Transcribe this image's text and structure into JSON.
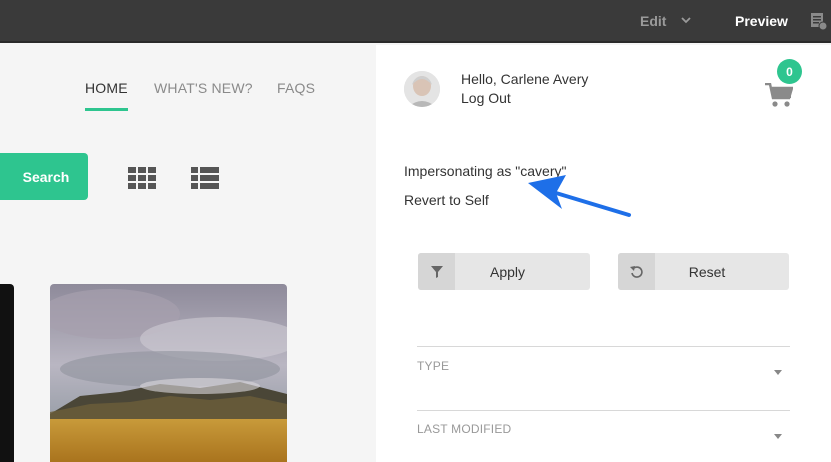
{
  "topbar": {
    "edit_label": "Edit",
    "preview_label": "Preview",
    "icons": [
      "chevron-down-icon",
      "panel-settings-icon"
    ]
  },
  "nav": {
    "items": [
      {
        "label": "HOME",
        "active": true
      },
      {
        "label": "WHAT'S NEW?",
        "active": false
      },
      {
        "label": "FAQS",
        "active": false
      }
    ]
  },
  "search": {
    "button_label": "Search"
  },
  "view_toggle": {
    "icons": [
      "grid-view-icon",
      "list-view-icon"
    ]
  },
  "user": {
    "greeting": "Hello, Carlene Avery",
    "logout_label": "Log Out",
    "cart_count": "0"
  },
  "impersonation": {
    "status": "Impersonating as \"cavery\"",
    "revert_label": "Revert to Self"
  },
  "actions": {
    "apply_label": "Apply",
    "reset_label": "Reset"
  },
  "filters": [
    {
      "label": "TYPE"
    },
    {
      "label": "LAST MODIFIED"
    }
  ],
  "colors": {
    "accent": "#2ec58f",
    "topbar": "#3a3a3a",
    "annotation_arrow": "#1e6fe8"
  }
}
